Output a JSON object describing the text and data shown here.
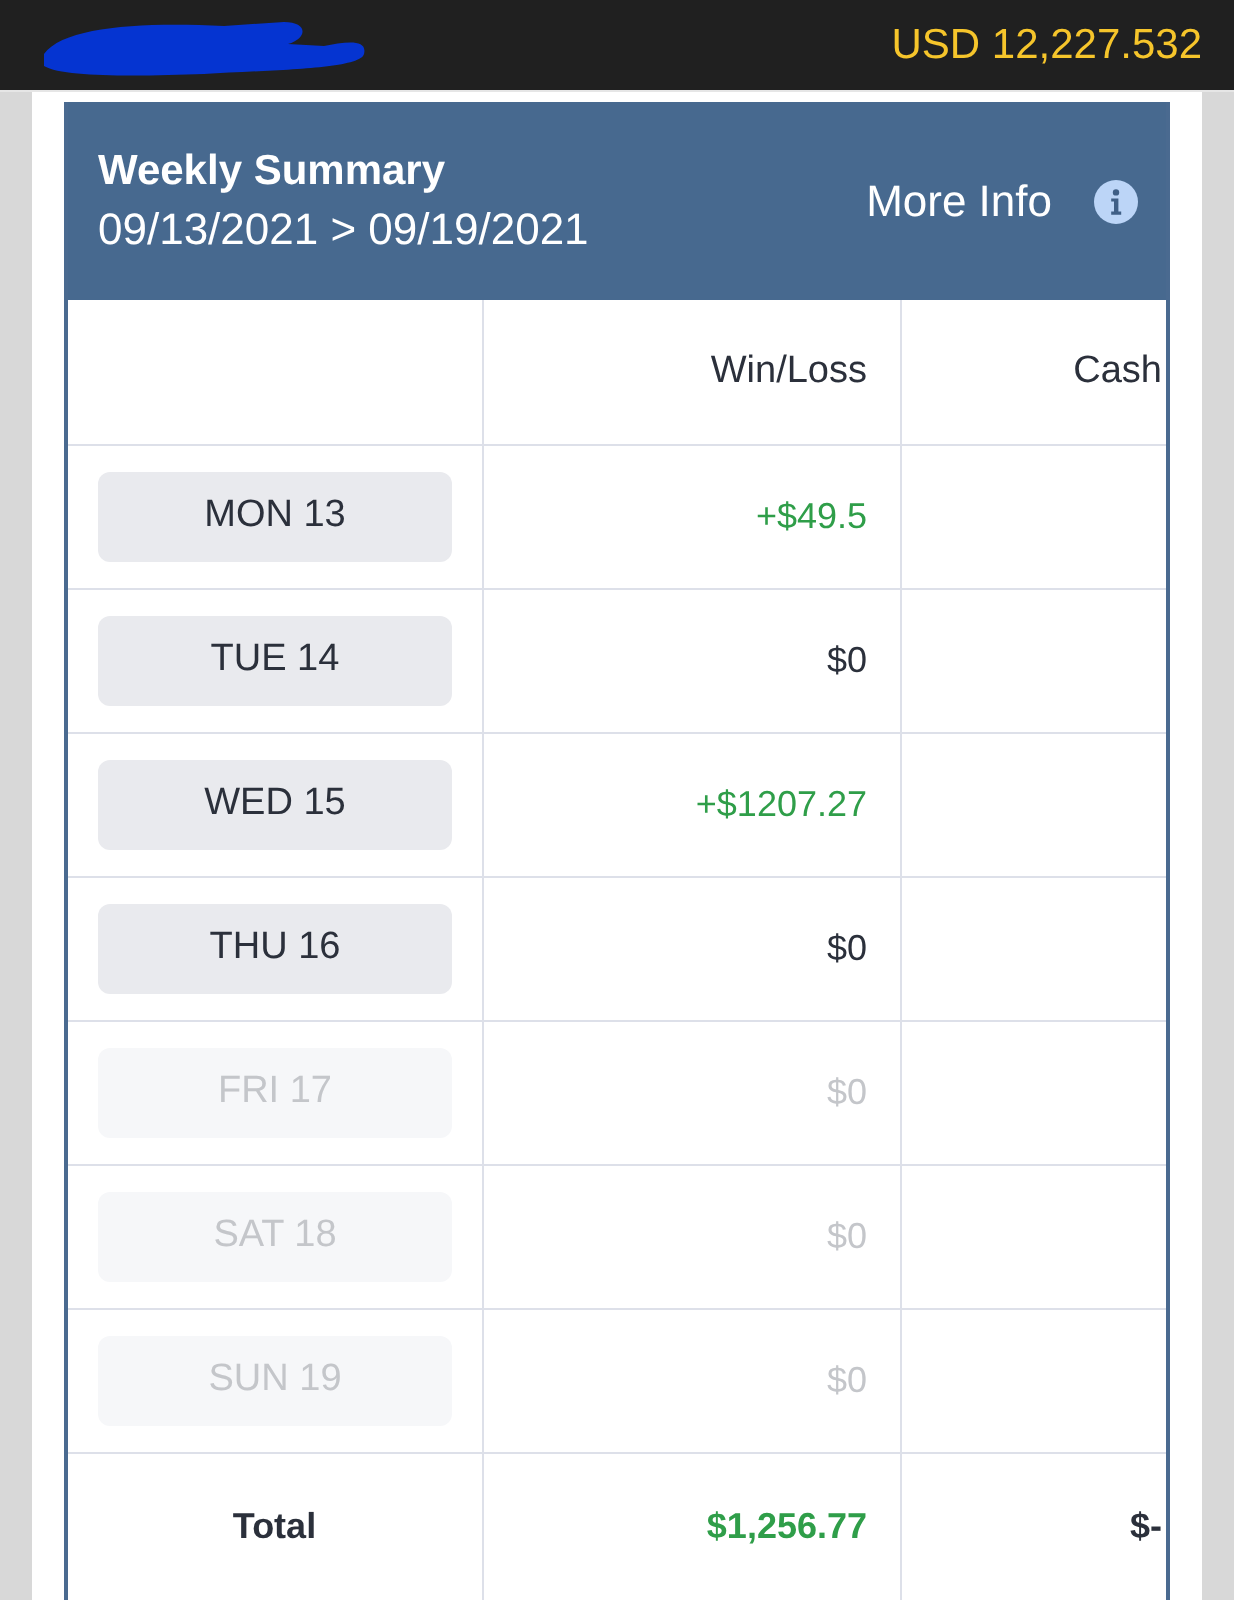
{
  "top_bar": {
    "balance": "USD 12,227.532"
  },
  "summary": {
    "title": "Weekly Summary",
    "date_range": "09/13/2021 > 09/19/2021",
    "more_info": "More Info"
  },
  "table": {
    "columns": [
      "Win/Loss",
      "Cash"
    ],
    "rows": [
      {
        "day": "MON 13",
        "disabled": false,
        "win_loss": "+$49.5",
        "color": "#2f9e49"
      },
      {
        "day": "TUE 14",
        "disabled": false,
        "win_loss": "$0",
        "color": "#2b303b"
      },
      {
        "day": "WED 15",
        "disabled": false,
        "win_loss": "+$1207.27",
        "color": "#2f9e49"
      },
      {
        "day": "THU 16",
        "disabled": false,
        "win_loss": "$0",
        "color": "#2b303b"
      },
      {
        "day": "FRI 17",
        "disabled": true,
        "win_loss": "$0",
        "color": "#c4c6ca"
      },
      {
        "day": "SAT 18",
        "disabled": true,
        "win_loss": "$0",
        "color": "#c4c6ca"
      },
      {
        "day": "SUN 19",
        "disabled": true,
        "win_loss": "$0",
        "color": "#c4c6ca"
      }
    ],
    "total": {
      "label": "Total",
      "win_loss": "$1,256.77",
      "color": "#2f9e49",
      "cash": "$-"
    }
  }
}
